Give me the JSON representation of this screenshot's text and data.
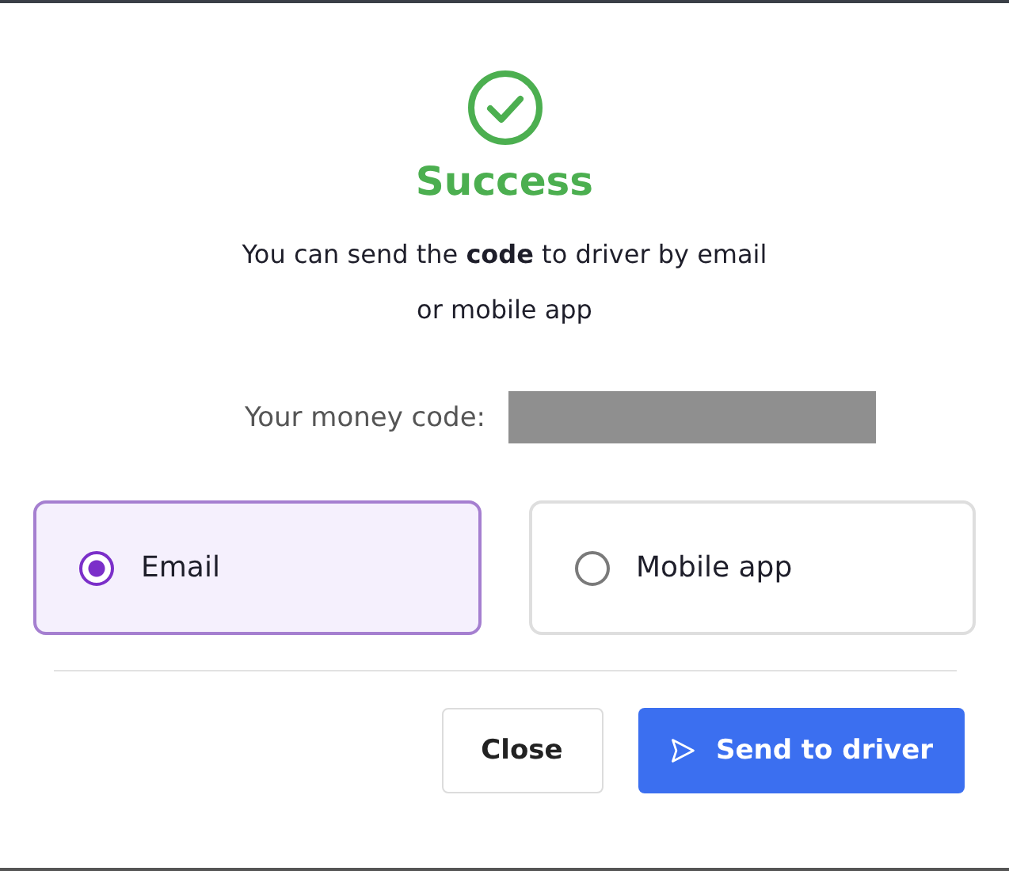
{
  "dialog": {
    "kind": "success",
    "title": "Success",
    "message": "You can send the **code** to driver by email\nor mobile app",
    "code_label": "Your money code:"
  },
  "options": [
    {
      "label": "Email",
      "selected": true
    },
    {
      "label": "Mobile app",
      "selected": false
    }
  ],
  "buttons": [
    {
      "label": "Close",
      "kind": "secondary"
    },
    {
      "label": "Send to driver",
      "kind": "primary"
    }
  ]
}
